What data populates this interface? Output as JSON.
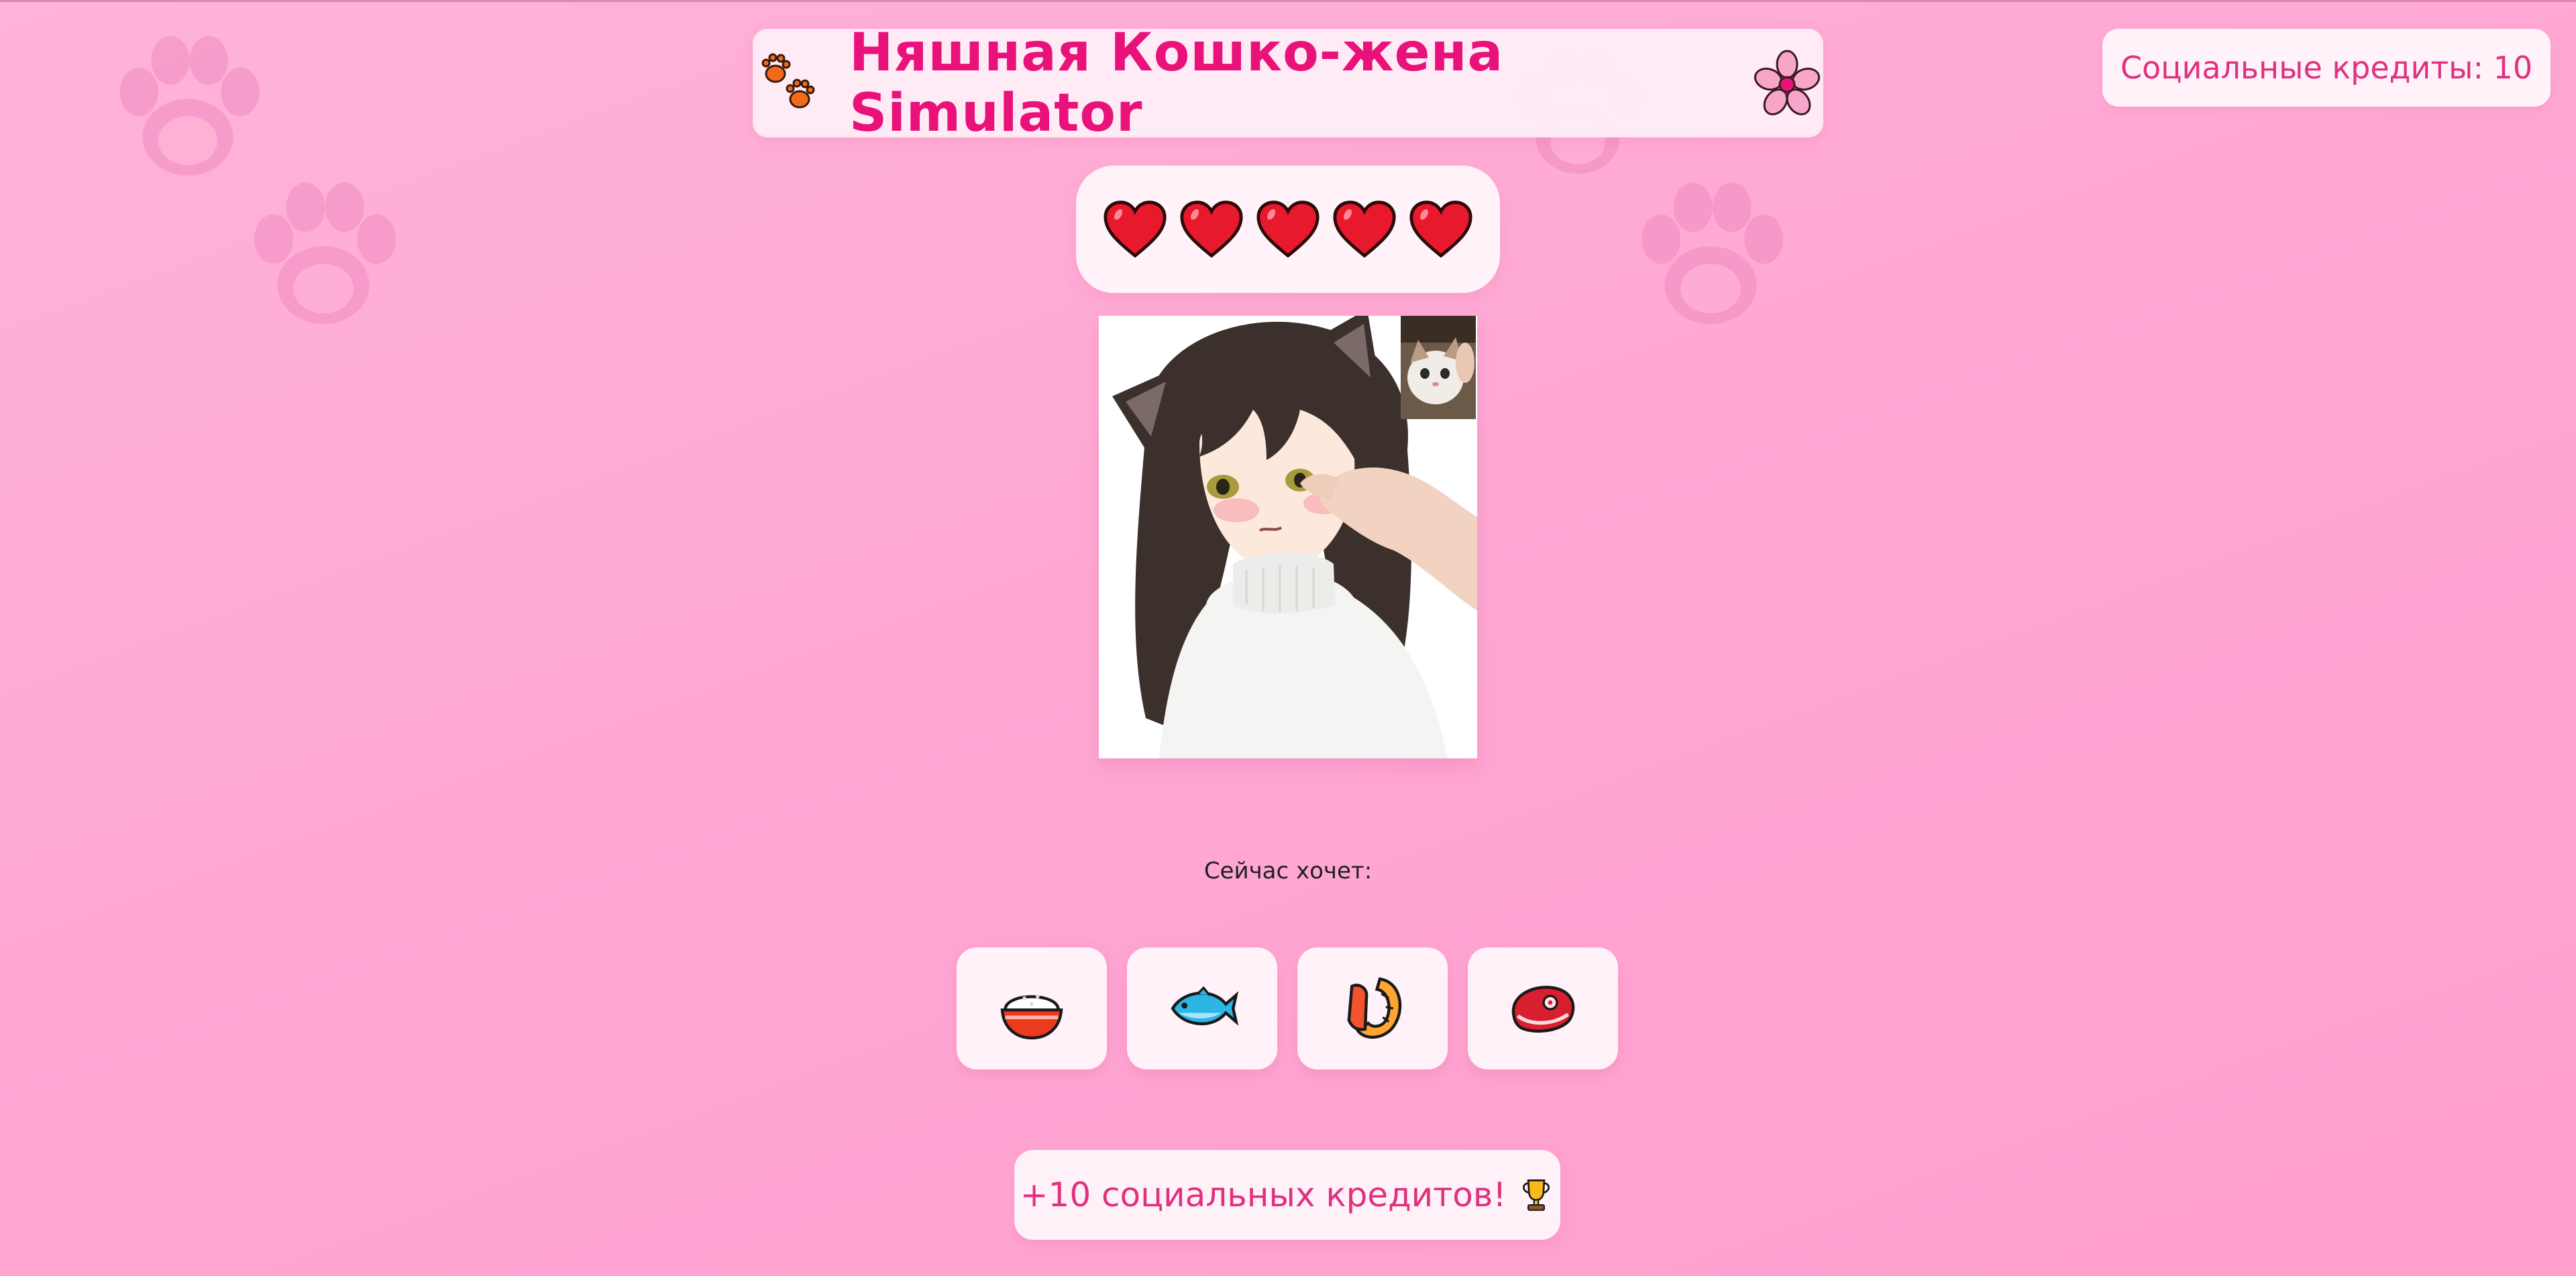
{
  "header": {
    "title": "Няшная Кошко-жена Simulator",
    "left_icon": "paw-prints-icon",
    "right_icon": "cherry-blossom-icon"
  },
  "credits": {
    "label": "Социальные кредиты: 10"
  },
  "hearts": {
    "count": 5,
    "icon": "heart-icon",
    "color": "#e8192c"
  },
  "portrait": {
    "subject": "cat-girl-portrait",
    "inset": "cat-photo"
  },
  "wants": {
    "label": "Сейчас хочет:"
  },
  "foods": [
    {
      "name": "rice-bowl-icon"
    },
    {
      "name": "fish-icon"
    },
    {
      "name": "shrimp-icon"
    },
    {
      "name": "meat-icon"
    }
  ],
  "reward": {
    "label": "+10 социальных кредитов!",
    "icon": "trophy-icon"
  },
  "colors": {
    "accent": "#e8127a",
    "background": "#ffa8d4"
  }
}
